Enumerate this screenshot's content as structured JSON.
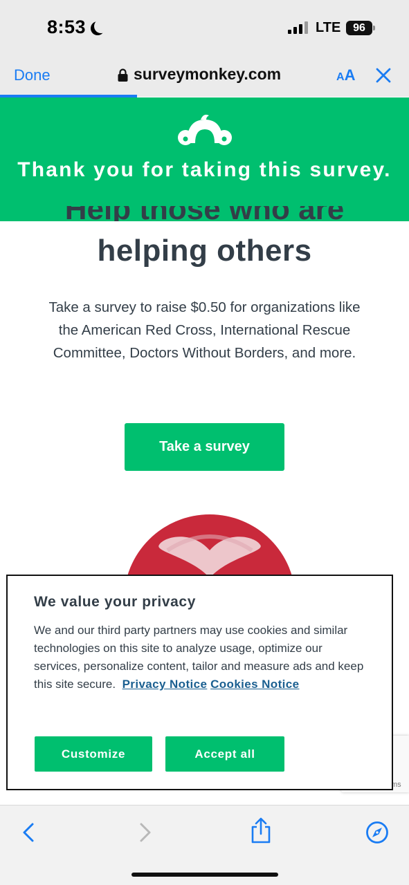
{
  "status_bar": {
    "time": "8:53",
    "network": "LTE",
    "battery": "96"
  },
  "browser": {
    "done_label": "Done",
    "url": "surveymonkey.com",
    "text_size_small": "A",
    "text_size_large": "A"
  },
  "banner": {
    "message": "Thank you for taking this survey."
  },
  "page": {
    "headline_partial": "Help those who are",
    "headline": "helping others",
    "description": "Take a survey to raise $0.50 for organizations like the American Red Cross, International Rescue Committee, Doctors Without Borders, and more.",
    "cta_label": "Take a survey"
  },
  "recaptcha": {
    "text": "ms"
  },
  "privacy": {
    "title": "We value your privacy",
    "body": "We and our third party partners may use cookies and similar technologies on this site to analyze usage, optimize our services, personalize content, tailor and measure ads and keep this site secure.",
    "privacy_link": "Privacy Notice",
    "cookies_link": "Cookies Notice",
    "customize_label": "Customize",
    "accept_label": "Accept all"
  },
  "colors": {
    "brand_green": "#00bf6f",
    "ios_blue": "#1a7cf3",
    "text_dark": "#333e48",
    "link_blue": "#1a5f90"
  }
}
